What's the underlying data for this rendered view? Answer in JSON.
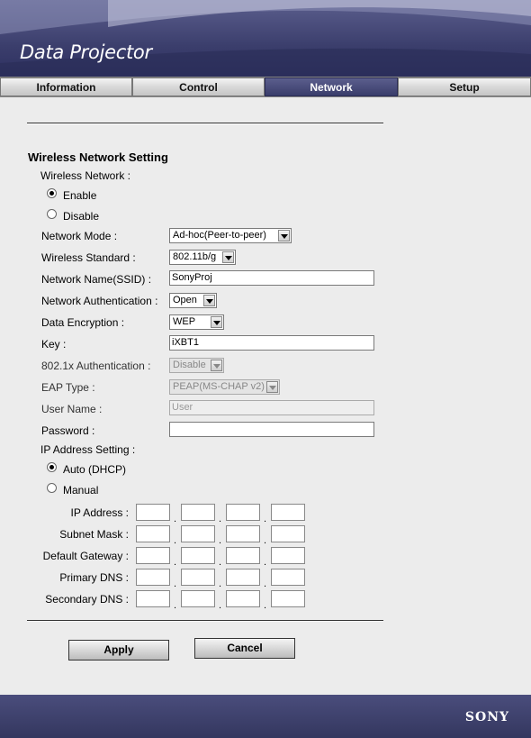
{
  "app": {
    "title": "Data Projector",
    "brand": "SONY"
  },
  "tabs": [
    {
      "label": "Information",
      "active": false
    },
    {
      "label": "Control",
      "active": false
    },
    {
      "label": "Network",
      "active": true
    },
    {
      "label": "Setup",
      "active": false
    }
  ],
  "section": {
    "title": "Wireless Network Setting"
  },
  "wireless": {
    "label": "Wireless Network :",
    "enable_label": "Enable",
    "disable_label": "Disable",
    "selected": "Enable"
  },
  "fields": {
    "network_mode": {
      "label": "Network Mode :",
      "value": "Ad-hoc(Peer-to-peer)"
    },
    "wireless_standard": {
      "label": "Wireless Standard :",
      "value": "802.11b/g"
    },
    "ssid": {
      "label": "Network Name(SSID) :",
      "value": "SonyProj"
    },
    "auth": {
      "label": "Network Authentication :",
      "value": "Open"
    },
    "encryption": {
      "label": "Data Encryption :",
      "value": "WEP"
    },
    "key": {
      "label": "Key :",
      "value": "iXBT1"
    },
    "dot1x": {
      "label": "802.1x Authentication :",
      "value": "Disable"
    },
    "eap": {
      "label": "EAP Type :",
      "value": "PEAP(MS-CHAP v2)"
    },
    "user": {
      "label": "User Name :",
      "value": "User"
    },
    "password": {
      "label": "Password :",
      "value": ""
    }
  },
  "ip": {
    "label": "IP Address Setting :",
    "auto_label": "Auto (DHCP)",
    "manual_label": "Manual",
    "selected": "Auto (DHCP)",
    "rows": [
      {
        "label": "IP Address :"
      },
      {
        "label": "Subnet Mask :"
      },
      {
        "label": "Default Gateway :"
      },
      {
        "label": "Primary DNS :"
      },
      {
        "label": "Secondary DNS :"
      }
    ],
    "separator": "."
  },
  "buttons": {
    "apply": "Apply",
    "cancel": "Cancel"
  },
  "colors": {
    "header": "#3b3e6c",
    "active_tab": "#3a3d6b",
    "page_bg": "#ececec"
  }
}
